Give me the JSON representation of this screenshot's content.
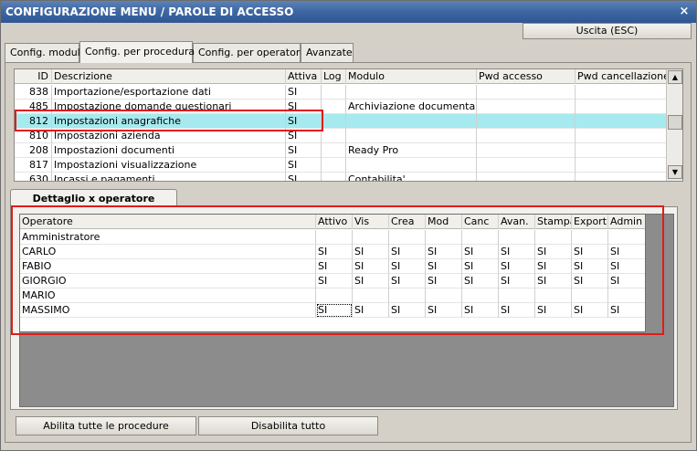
{
  "window": {
    "title": "CONFIGURAZIONE MENU / PAROLE DI ACCESSO",
    "close_glyph": "×"
  },
  "toolbar": {
    "exit_label": "Uscita (ESC)"
  },
  "tabs": [
    {
      "label": "Config. moduli"
    },
    {
      "label": "Config. per procedura"
    },
    {
      "label": "Config. per operatore"
    },
    {
      "label": "Avanzate"
    }
  ],
  "procedures": {
    "columns": [
      "ID",
      "Descrizione",
      "Attiva",
      "Log",
      "Modulo",
      "Pwd accesso",
      "Pwd cancellazione"
    ],
    "rows": [
      {
        "id": "838",
        "desc": "Importazione/esportazione dati",
        "attiva": "SI",
        "log": "",
        "modulo": "",
        "pwd": "",
        "pwdc": ""
      },
      {
        "id": "485",
        "desc": "Impostazione domande questionari",
        "attiva": "SI",
        "log": "",
        "modulo": "Archiviazione documentale",
        "pwd": "",
        "pwdc": ""
      },
      {
        "id": "812",
        "desc": "Impostazioni anagrafiche",
        "attiva": "SI",
        "log": "",
        "modulo": "",
        "pwd": "",
        "pwdc": ""
      },
      {
        "id": "810",
        "desc": "Impostazioni azienda",
        "attiva": "SI",
        "log": "",
        "modulo": "",
        "pwd": "",
        "pwdc": ""
      },
      {
        "id": "208",
        "desc": "Impostazioni documenti",
        "attiva": "SI",
        "log": "",
        "modulo": "Ready Pro",
        "pwd": "",
        "pwdc": ""
      },
      {
        "id": "817",
        "desc": "Impostazioni visualizzazione",
        "attiva": "SI",
        "log": "",
        "modulo": "",
        "pwd": "",
        "pwdc": ""
      },
      {
        "id": "630",
        "desc": "Incassi e pagamenti",
        "attiva": "SI",
        "log": "",
        "modulo": "Contabilita'",
        "pwd": "",
        "pwdc": ""
      }
    ],
    "selected_index": 2
  },
  "detail": {
    "tab_label": "Dettaglio x operatore",
    "columns": [
      "Operatore",
      "Attivo",
      "Vis",
      "Crea",
      "Mod",
      "Canc",
      "Avan.",
      "Stampa",
      "Export",
      "Admin"
    ],
    "rows": [
      {
        "name": "Amministratore",
        "v": [
          "",
          "",
          "",
          "",
          "",
          "",
          "",
          "",
          ""
        ]
      },
      {
        "name": "CARLO",
        "v": [
          "SI",
          "SI",
          "SI",
          "SI",
          "SI",
          "SI",
          "SI",
          "SI",
          "SI"
        ]
      },
      {
        "name": "FABIO",
        "v": [
          "SI",
          "SI",
          "SI",
          "SI",
          "SI",
          "SI",
          "SI",
          "SI",
          "SI"
        ]
      },
      {
        "name": "GIORGIO",
        "v": [
          "SI",
          "SI",
          "SI",
          "SI",
          "SI",
          "SI",
          "SI",
          "SI",
          "SI"
        ]
      },
      {
        "name": "MARIO",
        "v": [
          "",
          "",
          "",
          "",
          "",
          "",
          "",
          "",
          ""
        ]
      },
      {
        "name": "MASSIMO",
        "v": [
          "SI",
          "SI",
          "SI",
          "SI",
          "SI",
          "SI",
          "SI",
          "SI",
          "SI"
        ]
      }
    ]
  },
  "footer": {
    "enable_all_label": "Abilita tutte le procedure",
    "disable_all_label": "Disabilita tutto"
  },
  "colors": {
    "titlebar": "#3f68a3",
    "selected_row": "#a6eaef",
    "highlight": "#e11b1b"
  }
}
